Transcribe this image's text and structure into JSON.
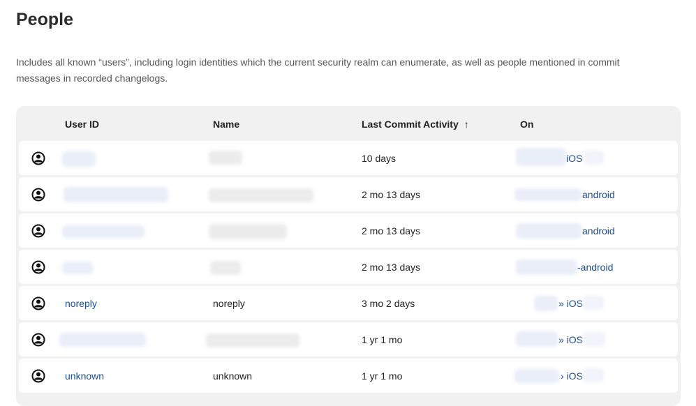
{
  "page": {
    "title": "People",
    "description": "Includes all known “users”, including login identities which the current security realm can enumerate, as well as people mentioned in commit messages in recorded changelogs."
  },
  "table": {
    "headers": {
      "user_id": "User ID",
      "name": "Name",
      "last_commit": "Last Commit Activity",
      "on": "On"
    },
    "sort_icon": "arrow-up-icon",
    "rows": [
      {
        "user_id": "",
        "name": "",
        "last_commit": "10 days",
        "on": "iOS"
      },
      {
        "user_id": "",
        "name": "",
        "last_commit": "2 mo 13 days",
        "on": "android"
      },
      {
        "user_id": "",
        "name": "",
        "last_commit": "2 mo 13 days",
        "on": "android"
      },
      {
        "user_id": "",
        "name": "",
        "last_commit": "2 mo 13 days",
        "on": "-android"
      },
      {
        "user_id": "noreply",
        "name": "noreply",
        "last_commit": "3 mo 2 days",
        "on": "» iOS"
      },
      {
        "user_id": "",
        "name": "",
        "last_commit": "1 yr 1 mo",
        "on": "» iOS"
      },
      {
        "user_id": "unknown",
        "name": "unknown",
        "last_commit": "1 yr 1 mo",
        "on": "› iOS"
      }
    ]
  },
  "icons": {
    "row_icon": "user-circle-icon"
  },
  "colors": {
    "link": "#1a4d8f",
    "table_bg": "#f1f1f1",
    "row_bg": "#ffffff"
  }
}
